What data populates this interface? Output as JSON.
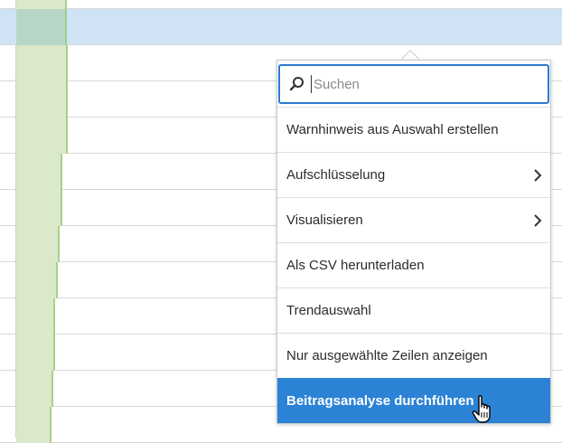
{
  "search": {
    "placeholder": "Suchen",
    "icon": "search-icon"
  },
  "menu": {
    "items": [
      {
        "label": "Warnhinweis aus Auswahl erstellen",
        "has_submenu": false
      },
      {
        "label": "Aufschlüsselung",
        "has_submenu": true
      },
      {
        "label": "Visualisieren",
        "has_submenu": true
      },
      {
        "label": "Als CSV herunterladen",
        "has_submenu": false
      },
      {
        "label": "Trendauswahl",
        "has_submenu": false
      },
      {
        "label": "Nur ausgewählte Zeilen anzeigen",
        "has_submenu": false
      },
      {
        "label": "Beitragsanalyse durchführen",
        "has_submenu": false,
        "active": true
      }
    ]
  },
  "colors": {
    "accent": "#2c83d6",
    "selected_row": "#cfe3f5",
    "bar_fill": "#d9e9c9"
  },
  "cursor_icon": "hand-pointer-icon"
}
